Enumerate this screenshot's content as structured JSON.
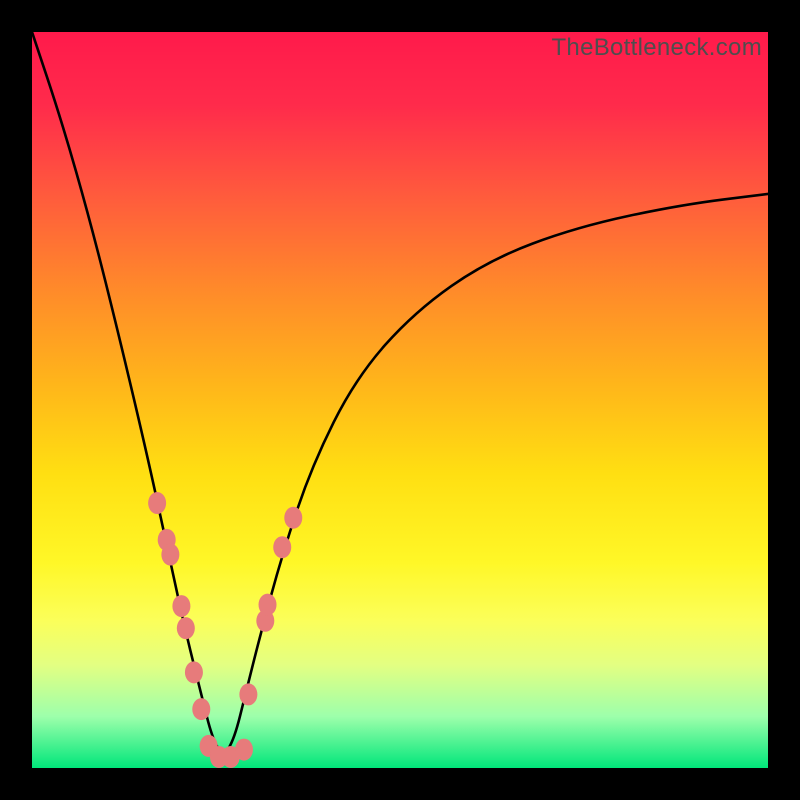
{
  "watermark": "TheBottleneck.com",
  "chart_data": {
    "type": "line",
    "title": "",
    "xlabel": "",
    "ylabel": "",
    "xlim": [
      0,
      100
    ],
    "ylim": [
      0,
      100
    ],
    "curve": {
      "note": "piecewise V-shaped bottleneck curve; y is distance from optimal (lower = better)",
      "x": [
        0,
        4,
        8,
        12,
        16,
        19,
        21,
        23,
        24.5,
        26,
        27.5,
        29,
        31,
        34,
        38,
        44,
        52,
        62,
        74,
        88,
        100
      ],
      "y": [
        100,
        88,
        74,
        58,
        41,
        27,
        18,
        10,
        4,
        1.5,
        4,
        10,
        18,
        29,
        41,
        53,
        62,
        69,
        73.5,
        76.5,
        78
      ]
    },
    "highlight_points": {
      "color": "#e77b7b",
      "points": [
        {
          "x": 17.0,
          "y": 36.0
        },
        {
          "x": 18.3,
          "y": 31.0
        },
        {
          "x": 18.8,
          "y": 29.0
        },
        {
          "x": 20.3,
          "y": 22.0
        },
        {
          "x": 20.9,
          "y": 19.0
        },
        {
          "x": 22.0,
          "y": 13.0
        },
        {
          "x": 23.0,
          "y": 8.0
        },
        {
          "x": 24.0,
          "y": 3.0
        },
        {
          "x": 25.4,
          "y": 1.5
        },
        {
          "x": 27.0,
          "y": 1.5
        },
        {
          "x": 28.8,
          "y": 2.5
        },
        {
          "x": 29.4,
          "y": 10.0
        },
        {
          "x": 31.7,
          "y": 20.0
        },
        {
          "x": 32.0,
          "y": 22.2
        },
        {
          "x": 34.0,
          "y": 30.0
        },
        {
          "x": 35.5,
          "y": 34.0
        }
      ]
    }
  }
}
